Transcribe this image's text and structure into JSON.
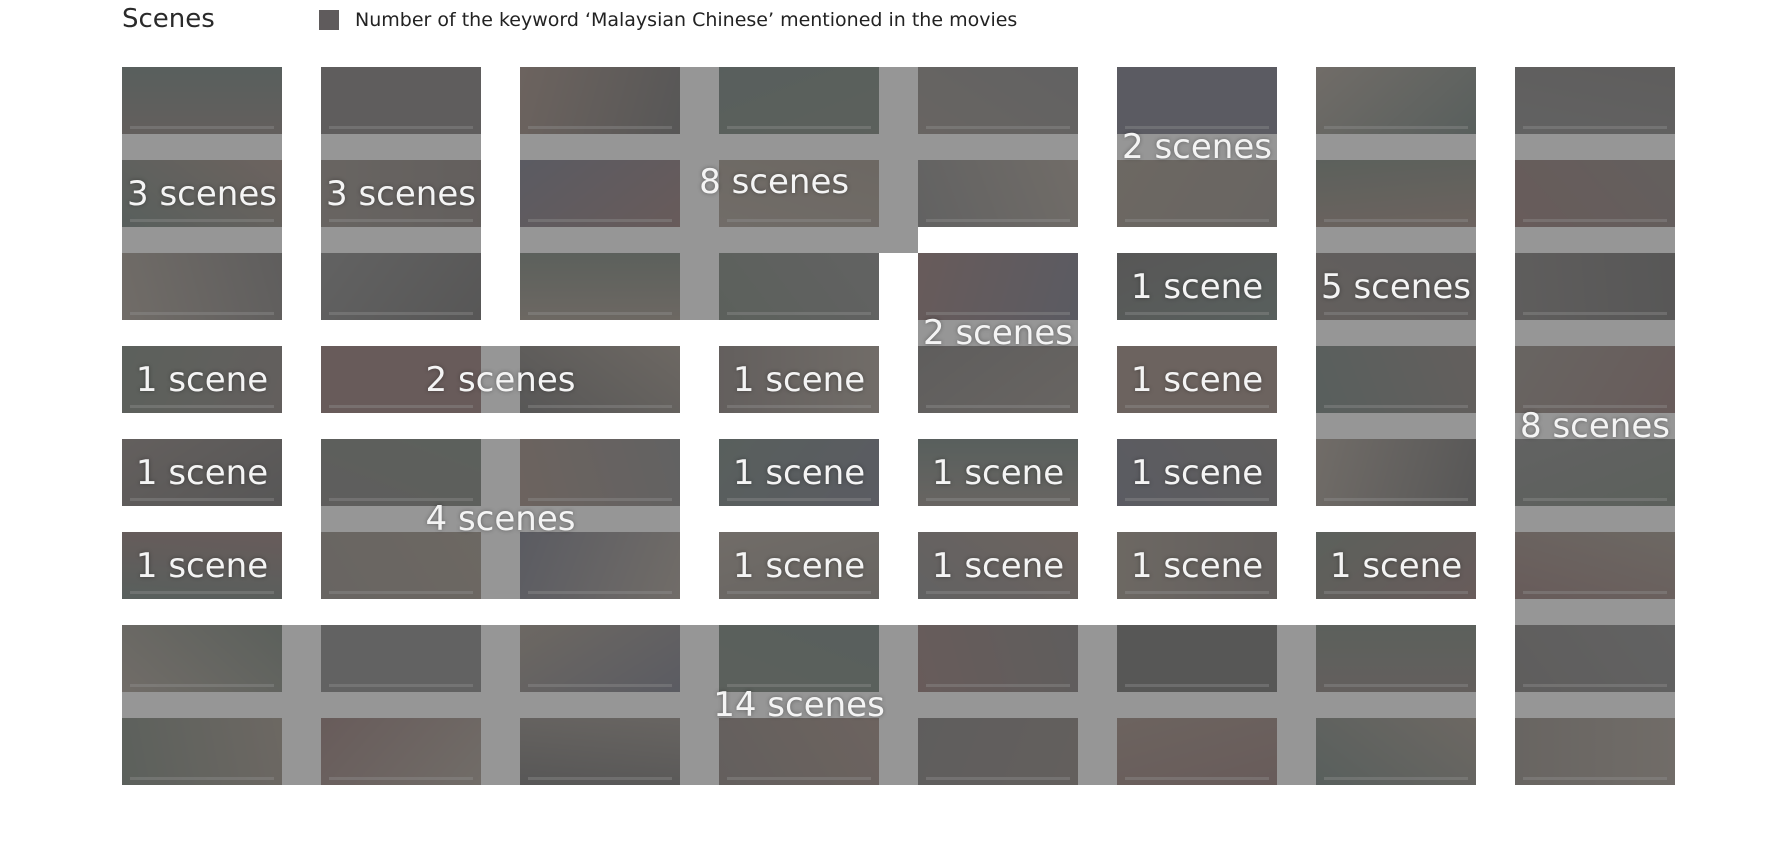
{
  "header": {
    "title": "Scenes",
    "legend_label": "Number of the keyword ‘Malaysian Chinese’ mentioned in the movies",
    "legend_color": "#5f5b5c"
  },
  "overlay_color": "#6e6e6e",
  "thumb_palette": [
    "#4a3b35",
    "#2b2e45",
    "#5a2e2a",
    "#233b33",
    "#6b5a48",
    "#3a3533",
    "#7a6a5a",
    "#1f1d1c",
    "#5b4f44",
    "#2f3f2f",
    "#6a4a3a",
    "#454545"
  ],
  "groups": [
    {
      "label": "3 scenes",
      "cells": [
        [
          0,
          0
        ],
        [
          0,
          1
        ],
        [
          0,
          2
        ]
      ]
    },
    {
      "label": "3 scenes",
      "cells": [
        [
          1,
          0
        ],
        [
          1,
          1
        ],
        [
          1,
          2
        ]
      ]
    },
    {
      "label": "8 scenes",
      "cells": [
        [
          2,
          0
        ],
        [
          3,
          0
        ],
        [
          4,
          0
        ],
        [
          2,
          1
        ],
        [
          3,
          1
        ],
        [
          4,
          1
        ],
        [
          2,
          2
        ],
        [
          3,
          2
        ]
      ]
    },
    {
      "label": "2 scenes",
      "cells": [
        [
          5,
          0
        ],
        [
          5,
          1
        ]
      ]
    },
    {
      "label": "2 scenes",
      "cells": [
        [
          4,
          2
        ],
        [
          4,
          3
        ]
      ]
    },
    {
      "label": "1 scene",
      "cells": [
        [
          5,
          2
        ]
      ]
    },
    {
      "label": "5 scenes",
      "cells": [
        [
          6,
          0
        ],
        [
          6,
          1
        ],
        [
          6,
          2
        ],
        [
          6,
          3
        ],
        [
          6,
          4
        ]
      ]
    },
    {
      "label": "8 scenes",
      "cells": [
        [
          7,
          0
        ],
        [
          7,
          1
        ],
        [
          7,
          2
        ],
        [
          7,
          3
        ],
        [
          7,
          4
        ],
        [
          7,
          5
        ],
        [
          7,
          6
        ],
        [
          7,
          7
        ]
      ]
    },
    {
      "label": "1 scene",
      "cells": [
        [
          0,
          3
        ]
      ]
    },
    {
      "label": "2 scenes",
      "cells": [
        [
          1,
          3
        ],
        [
          2,
          3
        ]
      ]
    },
    {
      "label": "1 scene",
      "cells": [
        [
          3,
          3
        ]
      ]
    },
    {
      "label": "1 scene",
      "cells": [
        [
          5,
          3
        ]
      ]
    },
    {
      "label": "1 scene",
      "cells": [
        [
          0,
          4
        ]
      ]
    },
    {
      "label": "4 scenes",
      "cells": [
        [
          1,
          4
        ],
        [
          2,
          4
        ],
        [
          1,
          5
        ],
        [
          2,
          5
        ]
      ]
    },
    {
      "label": "1 scene",
      "cells": [
        [
          3,
          4
        ]
      ]
    },
    {
      "label": "1 scene",
      "cells": [
        [
          4,
          4
        ]
      ]
    },
    {
      "label": "1 scene",
      "cells": [
        [
          5,
          4
        ]
      ]
    },
    {
      "label": "1 scene",
      "cells": [
        [
          0,
          5
        ]
      ]
    },
    {
      "label": "1 scene",
      "cells": [
        [
          3,
          5
        ]
      ]
    },
    {
      "label": "1 scene",
      "cells": [
        [
          4,
          5
        ]
      ]
    },
    {
      "label": "1 scene",
      "cells": [
        [
          5,
          5
        ]
      ]
    },
    {
      "label": "1 scene",
      "cells": [
        [
          6,
          5
        ]
      ]
    },
    {
      "label": "14 scenes",
      "cells": [
        [
          0,
          6
        ],
        [
          1,
          6
        ],
        [
          2,
          6
        ],
        [
          3,
          6
        ],
        [
          4,
          6
        ],
        [
          5,
          6
        ],
        [
          6,
          6
        ],
        [
          0,
          7
        ],
        [
          1,
          7
        ],
        [
          2,
          7
        ],
        [
          3,
          7
        ],
        [
          4,
          7
        ],
        [
          5,
          7
        ],
        [
          6,
          7
        ]
      ]
    }
  ]
}
